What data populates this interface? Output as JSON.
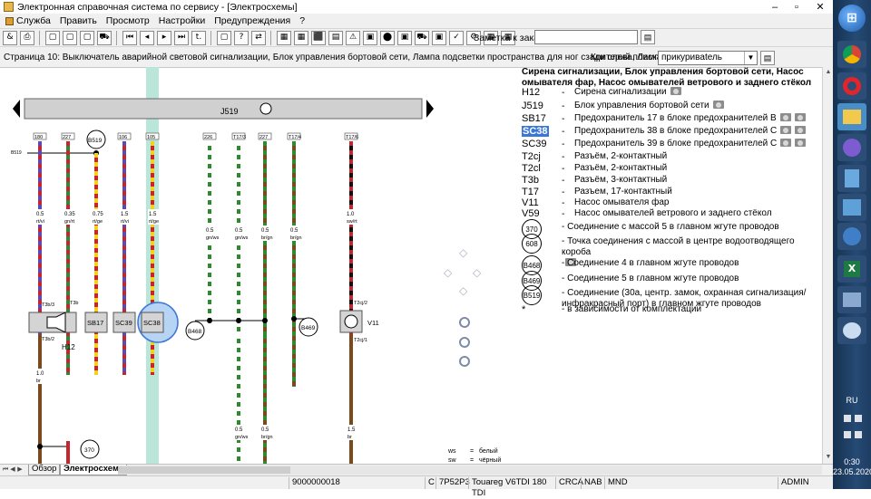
{
  "window": {
    "title": "Электронная справочная система по сервису - [Электросхемы]",
    "min": "–",
    "max": "▫",
    "close": "✕"
  },
  "menu": [
    "Служба",
    "Править",
    "Просмотр",
    "Настройки",
    "Предупреждения",
    "?"
  ],
  "toolbar": {
    "buttons": [
      "&",
      "⎙",
      "▢",
      "▢",
      "▢",
      "⛟",
      "⏮",
      "◂",
      "▸",
      "⏭",
      "t.",
      "▢",
      "?",
      "⇄",
      "▦",
      "▦",
      "⬛",
      "▤",
      "⚠",
      "▣",
      "⬤",
      "▣",
      "⛟",
      "▣",
      "✓",
      "⚙",
      "▦",
      "▦"
    ],
    "order_label": "Заметка к заказу:",
    "order_value": ""
  },
  "pagebar": {
    "title": "Страница 10: Выключатель аварийной световой сигнализации, Блок управления бортовой сети, Лампа подсветки пространства для ног сзади слева, Лампа",
    "criterion_label": "Критерий поиска:",
    "criterion_value": "прикуривatель"
  },
  "diagram": {
    "bus_label": "J519",
    "connector_pins": [
      "180",
      "227",
      "B519",
      "106",
      "105",
      "226",
      "T17/3",
      "227",
      "T17/4",
      "T17/6"
    ],
    "small_label": "B519",
    "wires": [
      {
        "size": "0.5",
        "color": "rt/vi"
      },
      {
        "size": "0.35",
        "color": "gn/rt"
      },
      {
        "size": "0.75",
        "color": "rt/ge"
      },
      {
        "size": "1.5",
        "color": "rt/vi"
      },
      {
        "size": "1.5",
        "color": "rt/ge"
      },
      {
        "size": "0.5",
        "color": "gn/ws"
      },
      {
        "size": "0.5",
        "color": "gn/ws"
      },
      {
        "size": "0.5",
        "color": "br/gn"
      },
      {
        "size": "0.5",
        "color": "br/gn"
      },
      {
        "size": "1.0",
        "color": "sw/rt"
      }
    ],
    "components": [
      "H12",
      "SB17",
      "SC39",
      "SC38",
      "B468",
      "B469",
      "V11"
    ],
    "pins": [
      "T3b/3",
      "T3b",
      "T3b/2",
      "T2cj/2",
      "T2cj/1"
    ],
    "lower_wires": [
      {
        "size": "1.0",
        "color": "br"
      },
      {
        "size": "0.5",
        "color": "gn/ws"
      },
      {
        "size": "0.5",
        "color": "br/gn"
      },
      {
        "size": "1.5",
        "color": "br"
      }
    ],
    "ground": "370",
    "color_codes": [
      {
        "code": "ws",
        "eq": "=",
        "name": "белый"
      },
      {
        "code": "sw",
        "eq": "=",
        "name": "чёрный"
      }
    ]
  },
  "legend": {
    "title": "Сирена сигнализации, Блок управления бортовой сети, Насос омывателя фар, Насос омывателей ветрового и заднего стёкол",
    "items": [
      {
        "code": "H12",
        "desc": "Сирена сигнализации",
        "cams": 1
      },
      {
        "code": "J519",
        "desc": "Блок управления бортовой сети",
        "cams": 1
      },
      {
        "code": "SB17",
        "desc": "Предохранитель 17 в блоке предохранителей B",
        "cams": 2
      },
      {
        "code": "SC38",
        "desc": "Предохранитель 38 в блоке предохранителей C",
        "cams": 2,
        "selected": true
      },
      {
        "code": "SC39",
        "desc": "Предохранитель 39 в блоке предохранителей C",
        "cams": 2
      },
      {
        "code": "T2cj",
        "desc": "Разъём, 2-контактный",
        "cams": 0
      },
      {
        "code": "T2cl",
        "desc": "Разъём, 2-контактный",
        "cams": 0
      },
      {
        "code": "T3b",
        "desc": "Разъём, 3-контактный",
        "cams": 0
      },
      {
        "code": "T17",
        "desc": "Разъем, 17-контактный",
        "cams": 0
      },
      {
        "code": "V11",
        "desc": "Насос омывателя фар",
        "cams": 0
      },
      {
        "code": "V59",
        "desc": "Насос омывателей ветрового и заднего стёкол",
        "cams": 0
      }
    ],
    "circles": [
      {
        "code": "370",
        "desc": "Соединение с массой 5 в главном жгуте проводов"
      },
      {
        "code": "608",
        "desc": "Точка соединения с массой в центре водоотводящего короба"
      },
      {
        "code": "B468",
        "desc": "Соединение 4 в главном жгуте проводов"
      },
      {
        "code": "B469",
        "desc": "Соединение 5 в главном жгуте проводов"
      },
      {
        "code": "B519",
        "desc": "Соединение (30а, центр. замок, охранная сигнализация/инфракрасный порт) в главном жгуте проводов"
      }
    ],
    "footnote": {
      "code": "*",
      "desc": "в зависимости от комплектации"
    }
  },
  "tabs": [
    "Обзор",
    "Электросхема"
  ],
  "status": [
    "9000000018",
    "C",
    "7P52P3",
    "Touareg V6TDI 180 TDI",
    "CRCA",
    "NAB",
    "MND",
    "ADMIN"
  ],
  "tray": {
    "lang": "RU",
    "time": "0:30",
    "date": "23.05.2020"
  },
  "colors": {
    "accent": "#3a78d8",
    "highlight_column": "#b9e6d9",
    "taskbar": "#1e3d62"
  }
}
